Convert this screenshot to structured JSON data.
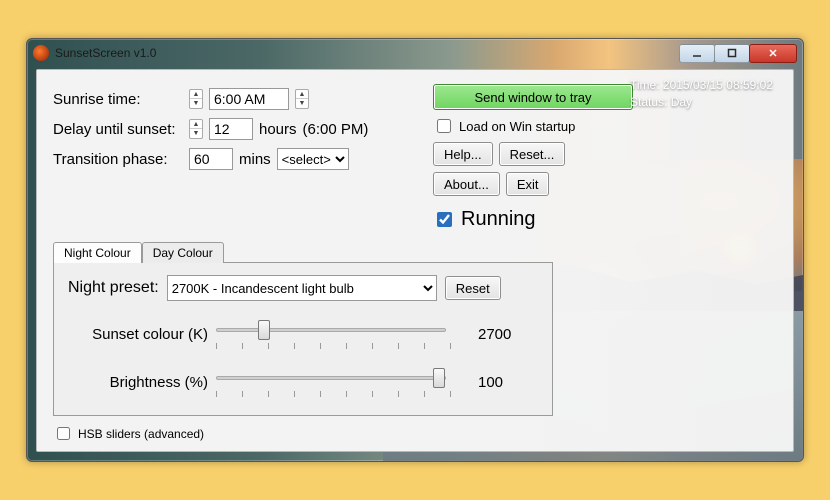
{
  "window": {
    "title": "SunsetScreen v1.0"
  },
  "overlay": {
    "time_line": "Time: 2015/03/15 08:59:02",
    "status_line": "Status: Day"
  },
  "form": {
    "sunrise_label": "Sunrise time:",
    "sunrise_value": "6:00 AM",
    "delay_label": "Delay until sunset:",
    "delay_value": "12",
    "delay_unit": "hours",
    "delay_result": "(6:00 PM)",
    "transition_label": "Transition phase:",
    "transition_value": "60",
    "transition_unit": "mins",
    "transition_select": "<select>"
  },
  "right": {
    "tray_btn": "Send window to tray",
    "load_startup": "Load on Win startup",
    "help_btn": "Help...",
    "reset_btn": "Reset...",
    "about_btn": "About...",
    "exit_btn": "Exit",
    "running_label": "Running"
  },
  "tabs": {
    "night": "Night Colour",
    "day": "Day Colour"
  },
  "night": {
    "preset_label": "Night preset:",
    "preset_value": "2700K - Incandescent light bulb",
    "reset_btn": "Reset",
    "colour_label": "Sunset colour (K)",
    "colour_value": "2700",
    "brightness_label": "Brightness (%)",
    "brightness_value": "100"
  },
  "hsb": {
    "label": "HSB sliders (advanced)"
  }
}
